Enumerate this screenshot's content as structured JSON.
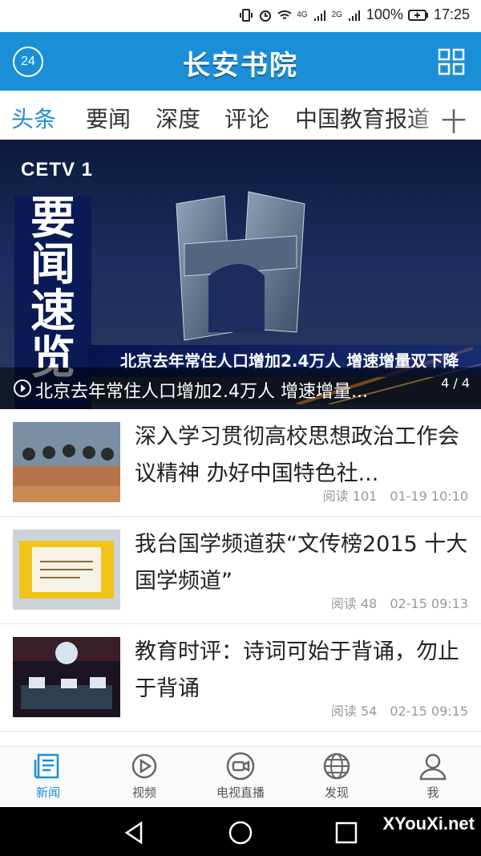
{
  "status_bar": {
    "net_a": "4G",
    "net_b": "2G",
    "battery": "100%",
    "time": "17:25"
  },
  "header": {
    "badge": "24",
    "logo": "长安书院"
  },
  "tabs": [
    {
      "label": "头条"
    },
    {
      "label": "要闻"
    },
    {
      "label": "深度"
    },
    {
      "label": "评论"
    },
    {
      "label": "中国教育报道"
    }
  ],
  "tabs_plus": "十",
  "banner": {
    "channel": "CETV 1",
    "side_title": [
      "要",
      "闻",
      "速",
      "览"
    ],
    "overlay": "北京去年常住人口增加2.4万人 增速增量双下降",
    "caption": "北京去年常住人口增加2.4万人 增速增量...",
    "pager": "4 / 4"
  },
  "news": [
    {
      "title": "深入学习贯彻高校思想政治工作会议精神 办好中国特色社...",
      "reads": "阅读 101",
      "time": "01-19 10:10"
    },
    {
      "title": "我台国学频道获“文传榜2015 十大国学频道”",
      "reads": "阅读 48",
      "time": "02-15 09:13"
    },
    {
      "title": "教育时评：诗词可始于背诵，勿止于背诵",
      "reads": "阅读 54",
      "time": "02-15 09:15"
    }
  ],
  "bottom_nav": [
    {
      "label": "新闻",
      "icon": "newspaper-icon"
    },
    {
      "label": "视频",
      "icon": "play-circle-icon"
    },
    {
      "label": "电视直播",
      "icon": "video-camera-icon"
    },
    {
      "label": "发现",
      "icon": "globe-icon"
    },
    {
      "label": "我",
      "icon": "person-icon"
    }
  ],
  "watermark": "XYouXi.net",
  "colors": {
    "accent": "#1a8fd8",
    "header_bg": "#1a8fd8"
  }
}
